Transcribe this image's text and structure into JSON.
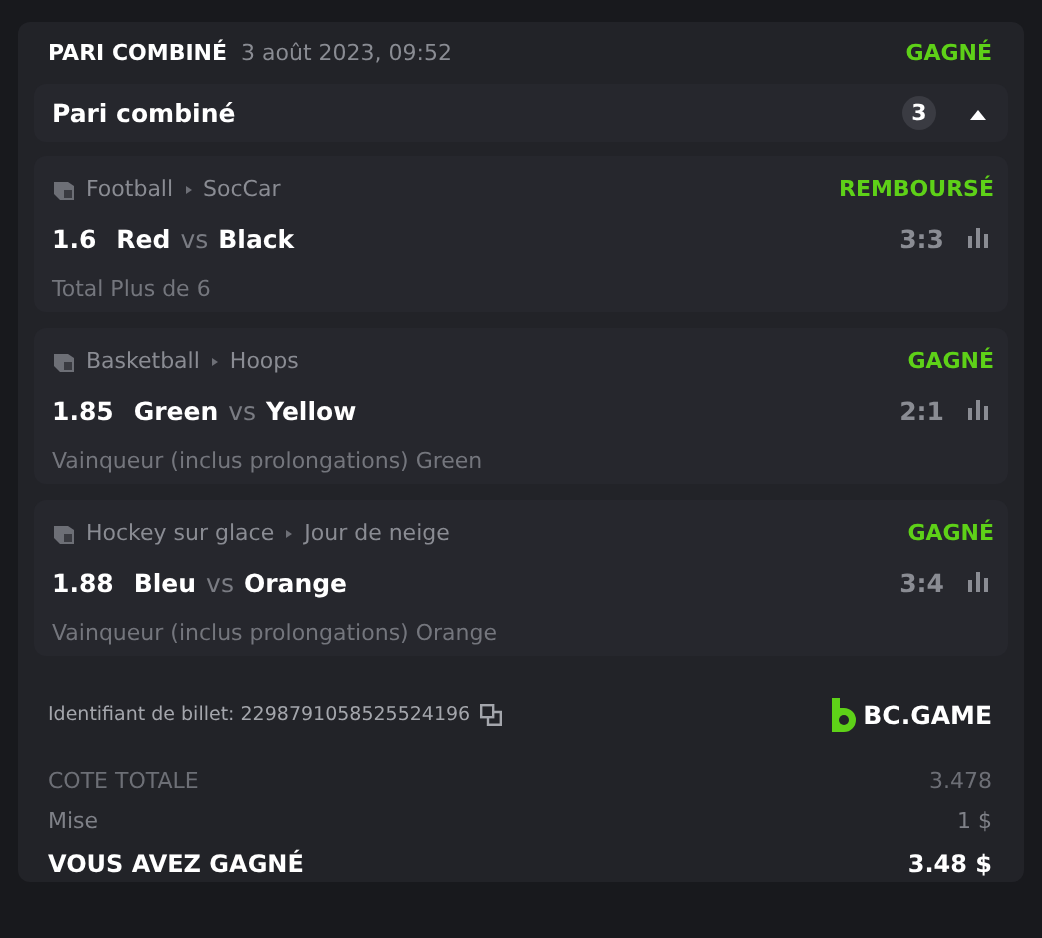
{
  "header": {
    "title": "PARI COMBINÉ",
    "date": "3 août 2023, 09:52",
    "status": "GAGNÉ"
  },
  "group": {
    "title": "Pari combiné",
    "count": "3",
    "expanded": true
  },
  "selections": [
    {
      "sport": "Football",
      "league": "SocCar",
      "status": "REMBOURSÉ",
      "odds": "1.6",
      "home": "Red",
      "vs": "vs",
      "away": "Black",
      "score": "3:3",
      "market": "Total Plus de 6"
    },
    {
      "sport": "Basketball",
      "league": "Hoops",
      "status": "GAGNÉ",
      "odds": "1.85",
      "home": "Green",
      "vs": "vs",
      "away": "Yellow",
      "score": "2:1",
      "market": "Vainqueur (inclus prolongations) Green"
    },
    {
      "sport": "Hockey sur glace",
      "league": "Jour de neige",
      "status": "GAGNÉ",
      "odds": "1.88",
      "home": "Bleu",
      "vs": "vs",
      "away": "Orange",
      "score": "3:4",
      "market": "Vainqueur (inclus prolongations) Orange"
    }
  ],
  "ticket": {
    "label": "Identifiant de billet: 2298791058525524196",
    "brand": "BC.GAME"
  },
  "totals": [
    {
      "kind": "muted",
      "label": "COTE TOTALE",
      "value": "3.478"
    },
    {
      "kind": "normal",
      "label": "Mise",
      "value": "1 $"
    },
    {
      "kind": "strong",
      "label": "VOUS AVEZ GAGNÉ",
      "value": "3.48 $"
    }
  ]
}
